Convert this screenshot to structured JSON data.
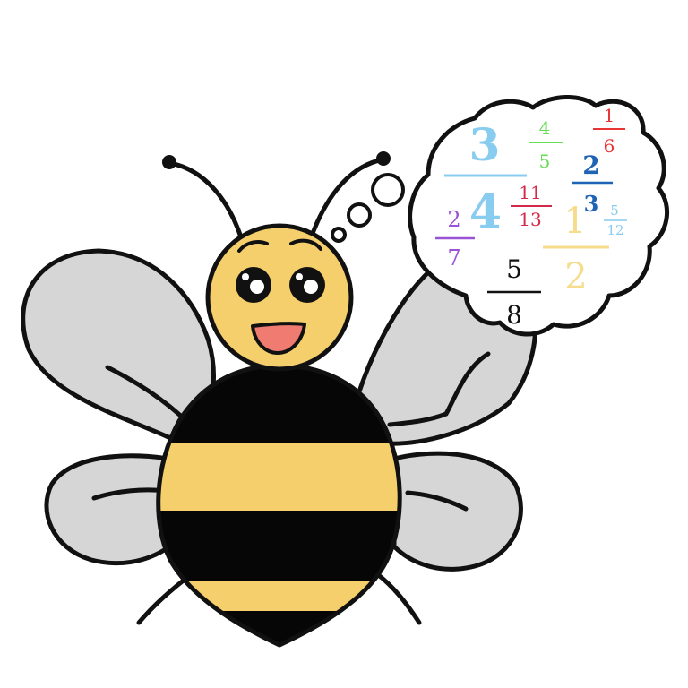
{
  "colors": {
    "outline": "#111111",
    "wing": "#d6d6d6",
    "body_yellow": "#f6cf6d",
    "body_black": "#060606",
    "head_yellow": "#f6cf6d",
    "mouth": "#f07b70",
    "cloud_fill": "#ffffff",
    "light_blue": "#88ccf0",
    "green": "#66dd55",
    "red": "#e83434",
    "dark_blue": "#1f64b4",
    "crimson": "#d42a4a",
    "purple": "#9a52d6",
    "pale_yellow": "#f6dc8c",
    "black_text": "#111111"
  },
  "thought": {
    "mixed_3": {
      "whole": "3",
      "numerator": "4",
      "denominator": "5"
    },
    "fraction_1_6": {
      "numerator": "1",
      "denominator": "6"
    },
    "mixed_2": {
      "whole": "2",
      "numerator": "3",
      "denominator": ""
    },
    "mixed_4": {
      "whole": "4",
      "numerator": "11",
      "denominator": "13"
    },
    "fraction_2_7": {
      "numerator": "2",
      "denominator": "7"
    },
    "mixed_1": {
      "whole": "1",
      "numerator": "5",
      "denominator": "12"
    },
    "fraction_5_8": {
      "numerator": "5",
      "denominator": "8"
    },
    "lone_2": "2"
  }
}
